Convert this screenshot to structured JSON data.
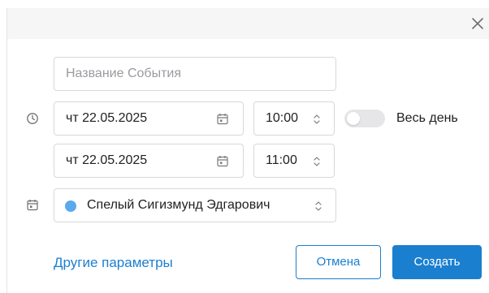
{
  "dialog": {
    "close_icon": "close-icon"
  },
  "title_field": {
    "placeholder": "Название События",
    "value": ""
  },
  "start": {
    "date": "чт 22.05.2025",
    "time": "10:00",
    "clock_icon": "clock-icon",
    "calendar_icon": "calendar-icon",
    "time_icon": "chevron-up-down-icon"
  },
  "end": {
    "date": "чт 22.05.2025",
    "time": "11:00",
    "calendar_icon": "calendar-icon",
    "time_icon": "chevron-up-down-icon"
  },
  "all_day": {
    "label": "Весь день",
    "enabled": false
  },
  "owner": {
    "name": "Спелый Сигизмунд Эдгарович",
    "color": "#5aa9ec",
    "row_icon": "calendar-icon",
    "chevron_icon": "chevron-up-down-icon"
  },
  "footer": {
    "more_link": "Другие параметры",
    "cancel_label": "Отмена",
    "create_label": "Создать"
  },
  "colors": {
    "accent": "#1b7fcf",
    "border": "#d8d8dc",
    "header_bg": "#f6f6f7",
    "placeholder": "#9a9aa0"
  }
}
